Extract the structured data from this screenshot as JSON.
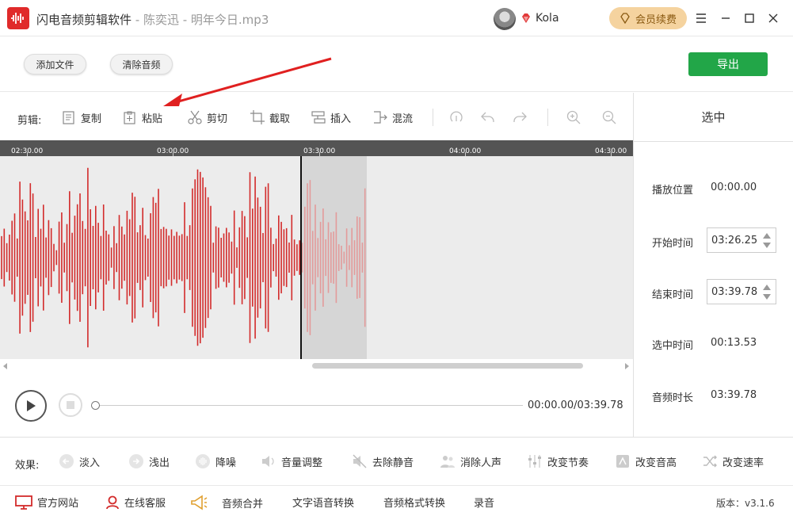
{
  "window": {
    "app_name": "闪电音频剪辑软件",
    "subtitle": " - 陈奕迅 - 明年今日.mp3",
    "username": "Kola",
    "vip_label": "会员续费"
  },
  "top_toolbar": {
    "add_file": "添加文件",
    "clear_audio": "清除音频",
    "export": "导出"
  },
  "edit_toolbar": {
    "label": "剪辑:",
    "copy": "复制",
    "paste": "粘贴",
    "cut": "剪切",
    "crop": "截取",
    "insert": "插入",
    "mix": "混流"
  },
  "timeline": {
    "ticks": [
      "02:30.00",
      "03:00.00",
      "03:30.00",
      "04:00.00",
      "04:30.00"
    ]
  },
  "playback": {
    "time": "00:00.00/03:39.78",
    "progress": 0
  },
  "right_panel": {
    "header": "选中",
    "play_position_label": "播放位置",
    "play_position": "00:00.00",
    "start_label": "开始时间",
    "start_value": "03:26.25",
    "end_label": "结束时间",
    "end_value": "03:39.78",
    "selected_label": "选中时间",
    "selected_value": "00:13.53",
    "duration_label": "音频时长",
    "duration_value": "03:39.78"
  },
  "effects": {
    "label": "效果:",
    "items": [
      "淡入",
      "浅出",
      "降噪",
      "音量调整",
      "去除静音",
      "消除人声",
      "改变节奏",
      "改变音高",
      "改变速率"
    ]
  },
  "footer": {
    "website": "官方网站",
    "support": "在线客服",
    "merge": "音频合并",
    "tts": "文字语音转换",
    "format": "音频格式转换",
    "record": "录音",
    "version": "版本：v3.1.6"
  },
  "colors": {
    "accent_red": "#d32b2b",
    "selection_red": "#e39a9a",
    "export_green": "#22a648",
    "vip_gold": "#f5d39f"
  }
}
